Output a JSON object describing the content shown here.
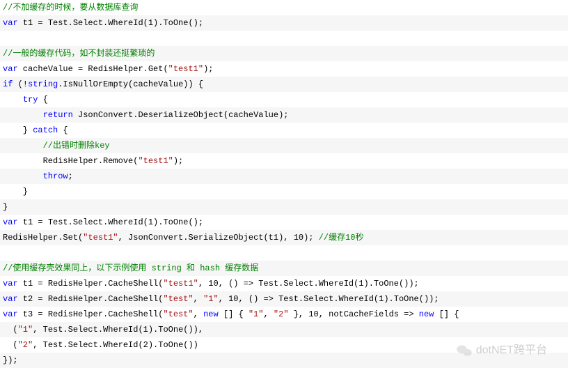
{
  "code": {
    "lines": [
      {
        "bg": "plain",
        "tokens": [
          {
            "t": "//不加缓存的时候，要从数据库查询",
            "c": "cmt"
          }
        ]
      },
      {
        "bg": "alt",
        "tokens": [
          {
            "t": "var",
            "c": "kw"
          },
          {
            "t": " t1 = Test.Select.WhereId(",
            "c": "plain"
          },
          {
            "t": "1",
            "c": "num"
          },
          {
            "t": ").ToOne();",
            "c": "plain"
          }
        ]
      },
      {
        "bg": "plain",
        "tokens": []
      },
      {
        "bg": "alt",
        "tokens": [
          {
            "t": "//一般的缓存代码，如不封装还挺繁琐的",
            "c": "cmt"
          }
        ]
      },
      {
        "bg": "plain",
        "tokens": [
          {
            "t": "var",
            "c": "kw"
          },
          {
            "t": " cacheValue = RedisHelper.Get(",
            "c": "plain"
          },
          {
            "t": "\"test1\"",
            "c": "str"
          },
          {
            "t": ");",
            "c": "plain"
          }
        ]
      },
      {
        "bg": "alt",
        "tokens": [
          {
            "t": "if",
            "c": "kw"
          },
          {
            "t": " (!",
            "c": "plain"
          },
          {
            "t": "string",
            "c": "kw"
          },
          {
            "t": ".IsNullOrEmpty(cacheValue)) {",
            "c": "plain"
          }
        ]
      },
      {
        "bg": "plain",
        "tokens": [
          {
            "t": "    ",
            "c": "plain"
          },
          {
            "t": "try",
            "c": "kw"
          },
          {
            "t": " {",
            "c": "plain"
          }
        ]
      },
      {
        "bg": "alt",
        "tokens": [
          {
            "t": "        ",
            "c": "plain"
          },
          {
            "t": "return",
            "c": "kw"
          },
          {
            "t": " JsonConvert.DeserializeObject(cacheValue);",
            "c": "plain"
          }
        ]
      },
      {
        "bg": "plain",
        "tokens": [
          {
            "t": "    } ",
            "c": "plain"
          },
          {
            "t": "catch",
            "c": "kw"
          },
          {
            "t": " {",
            "c": "plain"
          }
        ]
      },
      {
        "bg": "alt",
        "tokens": [
          {
            "t": "        ",
            "c": "plain"
          },
          {
            "t": "//出错时删除key",
            "c": "cmt"
          }
        ]
      },
      {
        "bg": "plain",
        "tokens": [
          {
            "t": "        RedisHelper.Remove(",
            "c": "plain"
          },
          {
            "t": "\"test1\"",
            "c": "str"
          },
          {
            "t": ");",
            "c": "plain"
          }
        ]
      },
      {
        "bg": "alt",
        "tokens": [
          {
            "t": "        ",
            "c": "plain"
          },
          {
            "t": "throw",
            "c": "kw"
          },
          {
            "t": ";",
            "c": "plain"
          }
        ]
      },
      {
        "bg": "plain",
        "tokens": [
          {
            "t": "    }",
            "c": "plain"
          }
        ]
      },
      {
        "bg": "alt",
        "tokens": [
          {
            "t": "}",
            "c": "plain"
          }
        ]
      },
      {
        "bg": "plain",
        "tokens": [
          {
            "t": "var",
            "c": "kw"
          },
          {
            "t": " t1 = Test.Select.WhereId(",
            "c": "plain"
          },
          {
            "t": "1",
            "c": "num"
          },
          {
            "t": ").ToOne();",
            "c": "plain"
          }
        ]
      },
      {
        "bg": "alt",
        "tokens": [
          {
            "t": "RedisHelper.Set(",
            "c": "plain"
          },
          {
            "t": "\"test1\"",
            "c": "str"
          },
          {
            "t": ", JsonConvert.SerializeObject(t1), ",
            "c": "plain"
          },
          {
            "t": "10",
            "c": "num"
          },
          {
            "t": "); ",
            "c": "plain"
          },
          {
            "t": "//缓存10秒",
            "c": "cmt"
          }
        ]
      },
      {
        "bg": "plain",
        "tokens": []
      },
      {
        "bg": "alt",
        "tokens": [
          {
            "t": "//使用缓存壳效果同上，以下示例使用 string 和 hash 缓存数据",
            "c": "cmt"
          }
        ]
      },
      {
        "bg": "plain",
        "tokens": [
          {
            "t": "var",
            "c": "kw"
          },
          {
            "t": " t1 = RedisHelper.CacheShell(",
            "c": "plain"
          },
          {
            "t": "\"test1\"",
            "c": "str"
          },
          {
            "t": ", ",
            "c": "plain"
          },
          {
            "t": "10",
            "c": "num"
          },
          {
            "t": ", () => Test.Select.WhereId(",
            "c": "plain"
          },
          {
            "t": "1",
            "c": "num"
          },
          {
            "t": ").ToOne());",
            "c": "plain"
          }
        ]
      },
      {
        "bg": "alt",
        "tokens": [
          {
            "t": "var",
            "c": "kw"
          },
          {
            "t": " t2 = RedisHelper.CacheShell(",
            "c": "plain"
          },
          {
            "t": "\"test\"",
            "c": "str"
          },
          {
            "t": ", ",
            "c": "plain"
          },
          {
            "t": "\"1\"",
            "c": "str"
          },
          {
            "t": ", ",
            "c": "plain"
          },
          {
            "t": "10",
            "c": "num"
          },
          {
            "t": ", () => Test.Select.WhereId(",
            "c": "plain"
          },
          {
            "t": "1",
            "c": "num"
          },
          {
            "t": ").ToOne());",
            "c": "plain"
          }
        ]
      },
      {
        "bg": "plain",
        "tokens": [
          {
            "t": "var",
            "c": "kw"
          },
          {
            "t": " t3 = RedisHelper.CacheShell(",
            "c": "plain"
          },
          {
            "t": "\"test\"",
            "c": "str"
          },
          {
            "t": ", ",
            "c": "plain"
          },
          {
            "t": "new",
            "c": "kw"
          },
          {
            "t": " [] { ",
            "c": "plain"
          },
          {
            "t": "\"1\"",
            "c": "str"
          },
          {
            "t": ", ",
            "c": "plain"
          },
          {
            "t": "\"2\"",
            "c": "str"
          },
          {
            "t": " }, ",
            "c": "plain"
          },
          {
            "t": "10",
            "c": "num"
          },
          {
            "t": ", notCacheFields => ",
            "c": "plain"
          },
          {
            "t": "new",
            "c": "kw"
          },
          {
            "t": " [] {",
            "c": "plain"
          }
        ]
      },
      {
        "bg": "alt",
        "tokens": [
          {
            "t": "  (",
            "c": "plain"
          },
          {
            "t": "\"1\"",
            "c": "str"
          },
          {
            "t": ", Test.Select.WhereId(",
            "c": "plain"
          },
          {
            "t": "1",
            "c": "num"
          },
          {
            "t": ").ToOne()),",
            "c": "plain"
          }
        ]
      },
      {
        "bg": "plain",
        "tokens": [
          {
            "t": "  (",
            "c": "plain"
          },
          {
            "t": "\"2\"",
            "c": "str"
          },
          {
            "t": ", Test.Select.WhereId(",
            "c": "plain"
          },
          {
            "t": "2",
            "c": "num"
          },
          {
            "t": ").ToOne())",
            "c": "plain"
          }
        ]
      },
      {
        "bg": "alt",
        "tokens": [
          {
            "t": "});",
            "c": "plain"
          }
        ]
      }
    ]
  },
  "watermark": {
    "text": "dotNET跨平台"
  }
}
